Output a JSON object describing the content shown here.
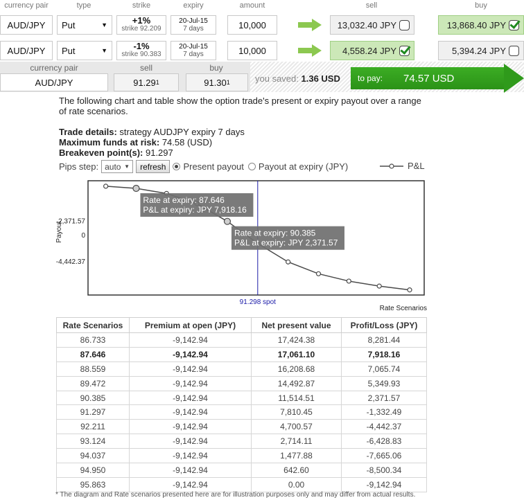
{
  "headers": {
    "currency_pair": "currency pair",
    "type": "type",
    "strike": "strike",
    "expiry": "expiry",
    "amount": "amount",
    "sell": "sell",
    "buy": "buy"
  },
  "legs": [
    {
      "pair": "AUD/JPY",
      "type": "Put",
      "pct": "+1%",
      "strike": "strike 92.209",
      "expiry_date": "20-Jul-15",
      "expiry_days": "7 days",
      "amount": "10,000",
      "sell": "13,032.40 JPY",
      "sell_checked": false,
      "buy": "13,868.40 JPY",
      "buy_checked": true
    },
    {
      "pair": "AUD/JPY",
      "type": "Put",
      "pct": "-1%",
      "strike": "strike 90.383",
      "expiry_date": "20-Jul-15",
      "expiry_days": "7 days",
      "amount": "10,000",
      "sell": "4,558.24 JPY",
      "sell_checked": true,
      "buy": "5,394.24 JPY",
      "buy_checked": false
    }
  ],
  "rate_box": {
    "h_pair": "currency pair",
    "h_sell": "sell",
    "h_buy": "buy",
    "pair": "AUD/JPY",
    "sell": "91.29",
    "sell_small": "1",
    "buy": "91.30",
    "buy_small": "1"
  },
  "summary": {
    "saved_label": "you saved:",
    "saved_value": "1.36 USD",
    "pay_label": "to pay:",
    "pay_value": "74.57 USD"
  },
  "description": {
    "intro": "The following chart and table show the option trade's present or expiry payout over a range of rate scenarios.",
    "trade_details_label": "Trade details:",
    "trade_details_value": " strategy AUDJPY expiry 7 days",
    "max_funds_label": "Maximum funds at risk:",
    "max_funds_value": " 74.58 (USD)",
    "breakeven_label": "Breakeven point(s):",
    "breakeven_value": " 91.297"
  },
  "controls": {
    "pips_label": "Pips step:",
    "pips_value": "auto",
    "refresh": "refresh",
    "present_payout": "Present payout",
    "expiry_payout": "Payout at expiry (JPY)",
    "legend": "P&L"
  },
  "chart_data": {
    "type": "line",
    "title": "",
    "xlabel": "Rate Scenarios",
    "ylabel": "Payout",
    "x": [
      86.733,
      87.646,
      88.559,
      89.472,
      90.385,
      91.297,
      92.211,
      93.124,
      94.037,
      94.95,
      95.863
    ],
    "series": [
      {
        "name": "P&L",
        "values": [
          8281.44,
          7918.16,
          7065.74,
          5349.93,
          2371.57,
          -1332.49,
          -4442.37,
          -6428.83,
          -7665.06,
          -8500.34,
          -9142.94
        ]
      }
    ],
    "yticks": [
      "2,371.57",
      "0",
      "-4,442.37"
    ],
    "ytick_values": [
      2371.57,
      0,
      -4442.37
    ],
    "ylim": [
      -10000,
      9200
    ],
    "xlim": [
      86.2,
      96.3
    ],
    "spot_value": 91.298,
    "spot_label": "91.298 spot",
    "tooltips": [
      {
        "line1": "Rate at expiry: 87.646",
        "line2": "P&L at expiry: JPY 7,918.16"
      },
      {
        "line1": "Rate at expiry: 90.385",
        "line2": "P&L at expiry: JPY 2,371.57"
      }
    ],
    "colors": {
      "line": "#4a4a4a",
      "spot": "#1a1aa8",
      "tooltip": "#6f6f6f"
    }
  },
  "table": {
    "headers": [
      "Rate Scenarios",
      "Premium at open (JPY)",
      "Net present value",
      "Profit/Loss (JPY)"
    ],
    "rows": [
      [
        "86.733",
        "-9,142.94",
        "17,424.38",
        "8,281.44"
      ],
      [
        "87.646",
        "-9,142.94",
        "17,061.10",
        "7,918.16"
      ],
      [
        "88.559",
        "-9,142.94",
        "16,208.68",
        "7,065.74"
      ],
      [
        "89.472",
        "-9,142.94",
        "14,492.87",
        "5,349.93"
      ],
      [
        "90.385",
        "-9,142.94",
        "11,514.51",
        "2,371.57"
      ],
      [
        "91.297",
        "-9,142.94",
        "7,810.45",
        "-1,332.49"
      ],
      [
        "92.211",
        "-9,142.94",
        "4,700.57",
        "-4,442.37"
      ],
      [
        "93.124",
        "-9,142.94",
        "2,714.11",
        "-6,428.83"
      ],
      [
        "94.037",
        "-9,142.94",
        "1,477.88",
        "-7,665.06"
      ],
      [
        "94.950",
        "-9,142.94",
        "642.60",
        "-8,500.34"
      ],
      [
        "95.863",
        "-9,142.94",
        "0.00",
        "-9,142.94"
      ]
    ],
    "highlight_row": 1
  },
  "footnote": "* The diagram and Rate scenarios presented here are for illustration purposes only and may differ from actual results."
}
